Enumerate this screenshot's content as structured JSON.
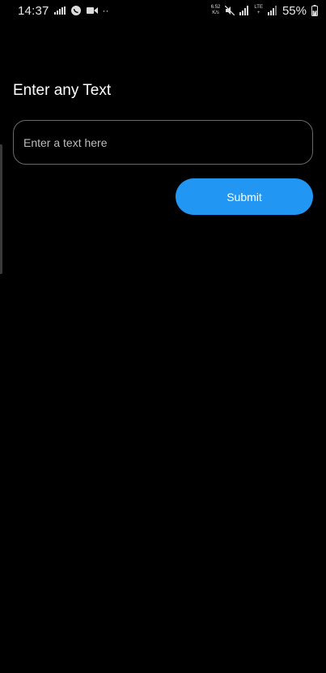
{
  "status_bar": {
    "time": "14:37",
    "net_speed_value": "6.52",
    "net_speed_unit": "K/s",
    "lte_top": "LTE",
    "lte_bottom": "+",
    "battery_percent": "55%",
    "more_notifications": "··",
    "icons": [
      "signal-bars-icon",
      "whatsapp-icon",
      "video-camera-icon",
      "mute-icon",
      "signal-icon",
      "battery-charging-icon"
    ]
  },
  "main": {
    "heading": "Enter any Text",
    "input": {
      "placeholder": "Enter a text here",
      "value": ""
    },
    "submit_label": "Submit"
  },
  "colors": {
    "background": "#000000",
    "accent": "#2196f3",
    "input_border": "#6a6a6a"
  }
}
